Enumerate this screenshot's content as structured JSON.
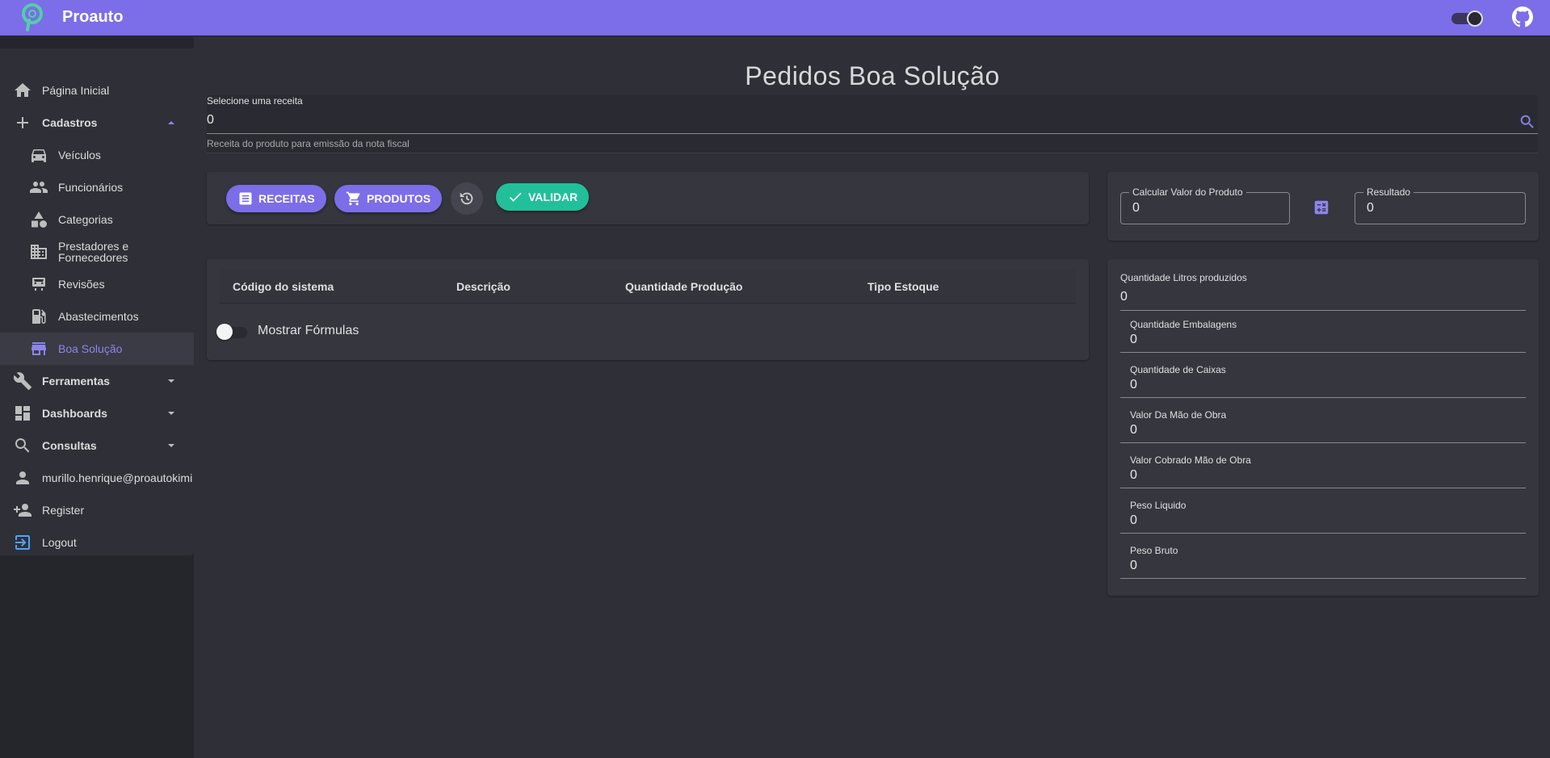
{
  "app": {
    "title": "Proauto"
  },
  "sidebar": {
    "items": [
      {
        "label": "Página Inicial"
      },
      {
        "label": "Cadastros"
      },
      {
        "label": "Veículos"
      },
      {
        "label": "Funcionários"
      },
      {
        "label": "Categorias"
      },
      {
        "label": "Prestadores e",
        "label2": "Fornecedores"
      },
      {
        "label": "Revisões"
      },
      {
        "label": "Abastecimentos"
      },
      {
        "label": "Boa Solução"
      },
      {
        "label": "Ferramentas"
      },
      {
        "label": "Dashboards"
      },
      {
        "label": "Consultas"
      },
      {
        "label": "murillo.henrique@proautokimi"
      },
      {
        "label": "Register"
      },
      {
        "label": "Logout"
      }
    ]
  },
  "page": {
    "title": "Pedidos Boa Solução"
  },
  "recipe": {
    "label": "Selecione uma receita",
    "value": "0",
    "hint": "Receita do produto para emissão da nota fiscal"
  },
  "toolbar": {
    "receitas_label": "RECEITAS",
    "produtos_label": "PRODUTOS",
    "validar_label": "VALIDAR"
  },
  "calc": {
    "input_label": "Calcular Valor do Produto",
    "input_value": "0",
    "result_label": "Resultado",
    "result_value": "0"
  },
  "table": {
    "headers": [
      "Código do sistema",
      "Descrição",
      "Quantidade Produção",
      "Tipo Estoque"
    ]
  },
  "formulas_toggle": {
    "label": "Mostrar Fórmulas"
  },
  "summary": {
    "fields": [
      {
        "label": "Quantidade Litros produzidos",
        "value": "0"
      },
      {
        "label": "Quantidade Embalagens",
        "value": "0"
      },
      {
        "label": "Quantidade de Caixas",
        "value": "0"
      },
      {
        "label": "Valor Da Mão de Obra",
        "value": "0"
      },
      {
        "label": "Valor Cobrado Mão de Obra",
        "value": "0"
      },
      {
        "label": "Peso Liquido",
        "value": "0"
      },
      {
        "label": "Peso Bruto",
        "value": "0"
      }
    ]
  },
  "colors": {
    "accent": "#7b6ee8",
    "success": "#22c09a",
    "background": "#2f3037"
  }
}
